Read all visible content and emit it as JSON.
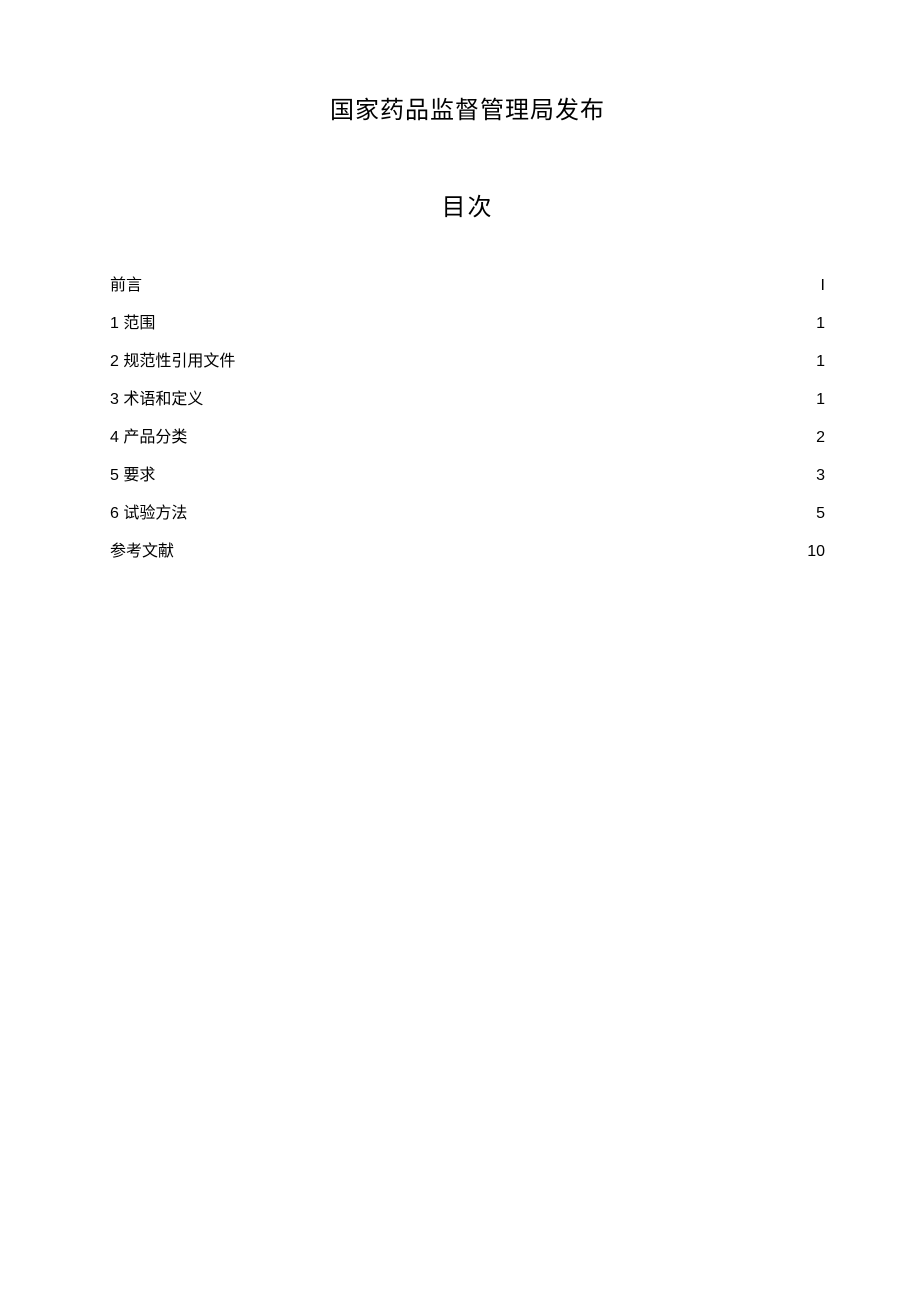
{
  "header": {
    "publisher": "国家药品监督管理局发布",
    "toc_title": "目次"
  },
  "toc": {
    "items": [
      {
        "label": "前言",
        "page": "I"
      },
      {
        "label": "1 范围",
        "page": "1"
      },
      {
        "label": "2 规范性引用文件",
        "page": "1"
      },
      {
        "label": "3 术语和定义",
        "page": "1"
      },
      {
        "label": "4 产品分类",
        "page": "2"
      },
      {
        "label": "5 要求",
        "page": "3"
      },
      {
        "label": "6 试验方法",
        "page": "5"
      },
      {
        "label": "参考文献",
        "page": "10"
      }
    ]
  }
}
